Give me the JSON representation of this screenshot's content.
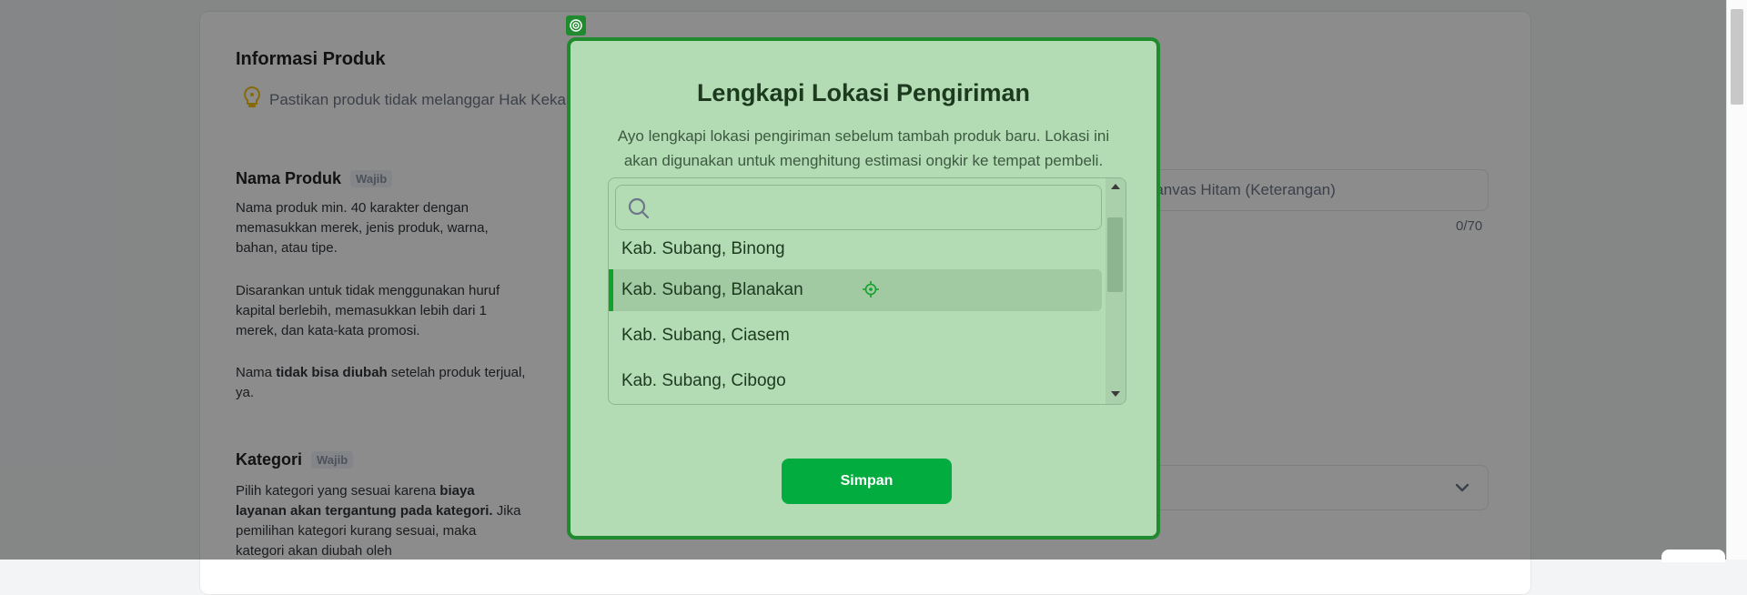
{
  "background": {
    "section_title": "Informasi Produk",
    "tip_text": "Pastikan produk tidak melanggar Hak Keka",
    "name_field": {
      "label": "Nama Produk",
      "badge": "Wajib",
      "desc1": "Nama produk min. 40 karakter dengan memasukkan merek, jenis produk, warna, bahan, atau tipe.",
      "desc2": "Disarankan untuk tidak menggunakan huruf kapital berlebih, memasukkan lebih dari 1 merek, dan kata-kata promosi.",
      "desc3_pre": "Nama ",
      "desc3_bold": "tidak bisa diubah",
      "desc3_post": " setelah produk terjual, ya.",
      "input_placeholder_visible": "Kanvas Hitam (Keterangan)",
      "counter": "0/70"
    },
    "category_field": {
      "label": "Kategori",
      "badge": "Wajib",
      "desc_pre": "Pilih kategori yang sesuai karena ",
      "desc_bold": "biaya layanan akan tergantung pada kategori.",
      "desc_post": " Jika pemilihan kategori kurang sesuai, maka kategori akan diubah oleh"
    }
  },
  "modal": {
    "title": "Lengkapi Lokasi Pengiriman",
    "description": "Ayo lengkapi lokasi pengiriman sebelum tambah produk baru. Lokasi ini akan digunakan untuk menghitung estimasi ongkir ke tempat pembeli.",
    "search": {
      "value": "",
      "placeholder": ""
    },
    "options": [
      {
        "label": "Kab. Subang, Binong",
        "selected": false
      },
      {
        "label": "Kab. Subang, Blanakan",
        "selected": true
      },
      {
        "label": "Kab. Subang, Ciasem",
        "selected": false
      },
      {
        "label": "Kab. Subang, Cibogo",
        "selected": false
      }
    ],
    "save_label": "Simpan"
  },
  "colors": {
    "modal_bg": "#b3dcb4",
    "modal_border": "#1f8b2e",
    "accent": "#03ac3e"
  }
}
